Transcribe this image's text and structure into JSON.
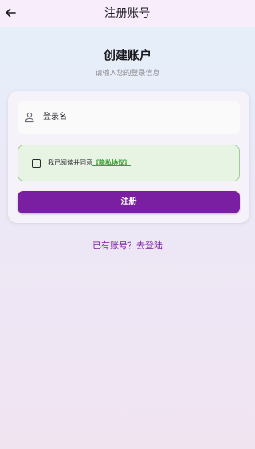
{
  "app_bar": {
    "back_icon": "arrow-left-icon",
    "title": "注册账号"
  },
  "header": {
    "title": "创建账户",
    "subtitle": "请输入您的登录信息"
  },
  "form": {
    "username": {
      "icon": "person-outline-icon",
      "placeholder": "登录名",
      "value": ""
    },
    "agreement": {
      "checked": false,
      "text": "我已阅读并同意",
      "link": "《隐私协议》"
    },
    "submit_label": "注册"
  },
  "footer": {
    "login_link": "已有账号？去登陆"
  },
  "colors": {
    "primary": "#7b1fa2",
    "agreement_bg": "#e7f4e4",
    "agreement_border": "#9ccb96",
    "link_green": "#3a9b40",
    "appbar_bg": "#f8eefb"
  }
}
